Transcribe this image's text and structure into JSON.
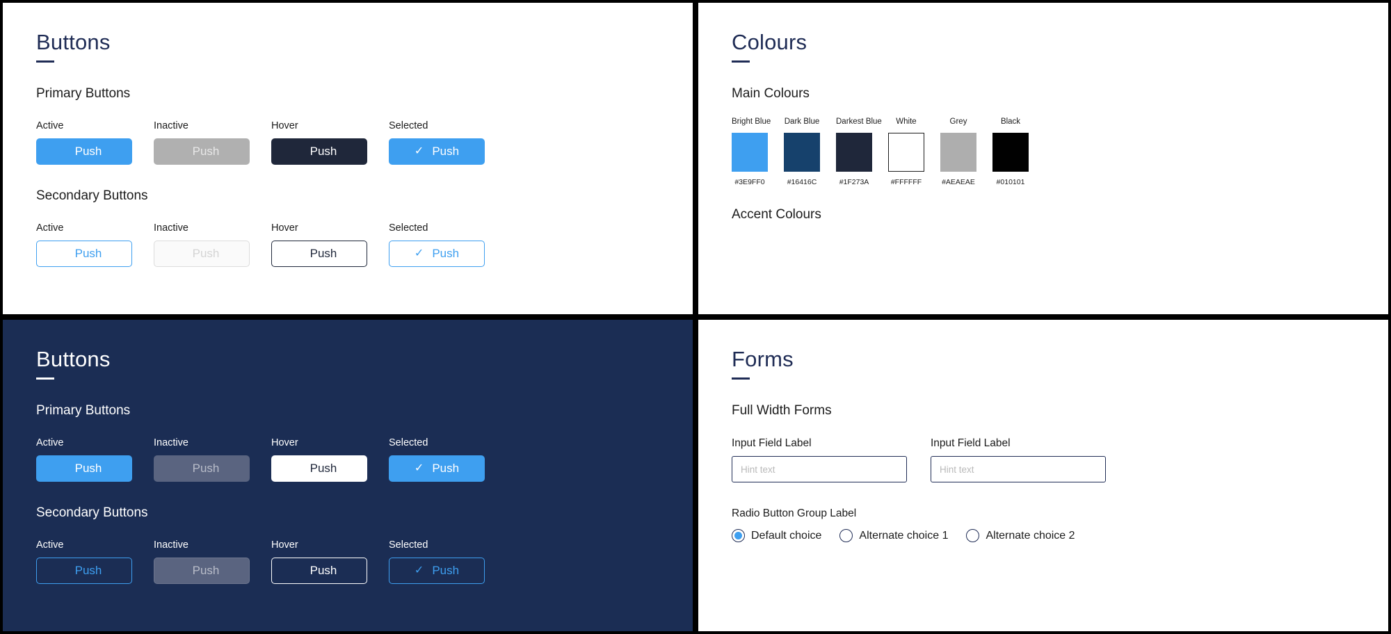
{
  "panels": {
    "buttons_light": {
      "title": "Buttons",
      "primary_heading": "Primary Buttons",
      "secondary_heading": "Secondary Buttons",
      "states": [
        "Active",
        "Inactive",
        "Hover",
        "Selected"
      ],
      "primary": [
        {
          "state": "Active",
          "label": "Push",
          "check": ""
        },
        {
          "state": "Inactive",
          "label": "Push",
          "check": ""
        },
        {
          "state": "Hover",
          "label": "Push",
          "check": ""
        },
        {
          "state": "Selected",
          "label": "Push",
          "check": "✓"
        }
      ],
      "secondary": [
        {
          "state": "Active",
          "label": "Push",
          "check": ""
        },
        {
          "state": "Inactive",
          "label": "Push",
          "check": ""
        },
        {
          "state": "Hover",
          "label": "Push",
          "check": ""
        },
        {
          "state": "Selected",
          "label": "Push",
          "check": "✓"
        }
      ]
    },
    "buttons_dark": {
      "title": "Buttons",
      "primary_heading": "Primary Buttons",
      "secondary_heading": "Secondary Buttons",
      "states": [
        "Active",
        "Inactive",
        "Hover",
        "Selected"
      ],
      "primary": [
        {
          "state": "Active",
          "label": "Push",
          "check": ""
        },
        {
          "state": "Inactive",
          "label": "Push",
          "check": ""
        },
        {
          "state": "Hover",
          "label": "Push",
          "check": ""
        },
        {
          "state": "Selected",
          "label": "Push",
          "check": "✓"
        }
      ],
      "secondary": [
        {
          "state": "Active",
          "label": "Push",
          "check": ""
        },
        {
          "state": "Inactive",
          "label": "Push",
          "check": ""
        },
        {
          "state": "Hover",
          "label": "Push",
          "check": ""
        },
        {
          "state": "Selected",
          "label": "Push",
          "check": "✓"
        }
      ]
    },
    "colours": {
      "title": "Colours",
      "main_heading": "Main Colours",
      "accent_heading": "Accent Colours",
      "swatches": [
        {
          "name": "Bright Blue",
          "hex": "#3E9FF0",
          "outlined": false
        },
        {
          "name": "Dark Blue",
          "hex": "#16416C",
          "outlined": false
        },
        {
          "name": "Darkest Blue",
          "hex": "#1F273A",
          "outlined": false
        },
        {
          "name": "White",
          "hex": "#FFFFFF",
          "outlined": true
        },
        {
          "name": "Grey",
          "hex": "#AEAEAE",
          "outlined": false
        },
        {
          "name": "Black",
          "hex": "#010101",
          "outlined": false
        }
      ]
    },
    "forms": {
      "title": "Forms",
      "full_width_heading": "Full Width Forms",
      "fields": [
        {
          "label": "Input Field Label",
          "value": "",
          "placeholder": "Hint text"
        },
        {
          "label": "Input Field Label",
          "value": "",
          "placeholder": "Hint text"
        }
      ],
      "radio_group_label": "Radio Button Group Label",
      "radios": [
        {
          "label": "Default choice",
          "checked": true
        },
        {
          "label": "Alternate choice 1",
          "checked": false
        },
        {
          "label": "Alternate choice 2",
          "checked": false
        }
      ]
    }
  }
}
